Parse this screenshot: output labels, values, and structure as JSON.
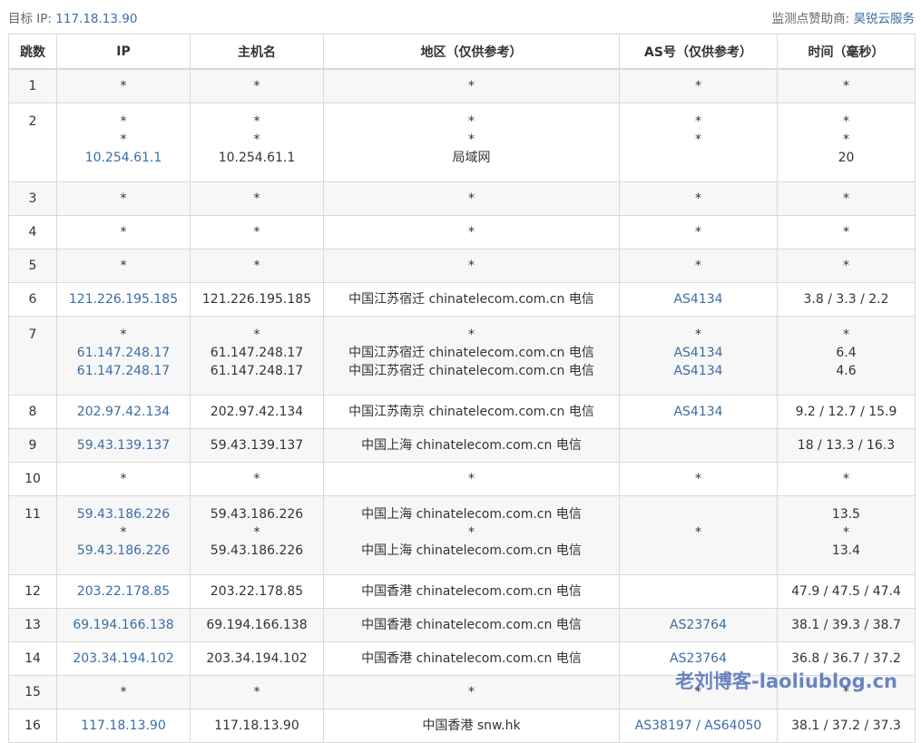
{
  "header": {
    "target_label": "目标 IP:",
    "target_ip": "117.18.13.90",
    "sponsor_label": "监测点赞助商:",
    "sponsor_name": "昊锐云服务"
  },
  "table": {
    "columns": [
      "跳数",
      "IP",
      "主机名",
      "地区（仅供参考）",
      "AS号（仅供参考）",
      "时间（毫秒）"
    ],
    "rows": [
      {
        "hop": "1",
        "ip": [
          "*"
        ],
        "host": [
          "*"
        ],
        "region": [
          "*"
        ],
        "as": [
          "*"
        ],
        "time": [
          "*"
        ]
      },
      {
        "hop": "2",
        "ip": [
          "*",
          "*",
          "10.254.61.1"
        ],
        "host": [
          "*",
          "*",
          "10.254.61.1"
        ],
        "region": [
          "*",
          "*",
          "局域网"
        ],
        "as": [
          "*",
          "*",
          ""
        ],
        "time": [
          "*",
          "*",
          "20"
        ]
      },
      {
        "hop": "3",
        "ip": [
          "*"
        ],
        "host": [
          "*"
        ],
        "region": [
          "*"
        ],
        "as": [
          "*"
        ],
        "time": [
          "*"
        ]
      },
      {
        "hop": "4",
        "ip": [
          "*"
        ],
        "host": [
          "*"
        ],
        "region": [
          "*"
        ],
        "as": [
          "*"
        ],
        "time": [
          "*"
        ]
      },
      {
        "hop": "5",
        "ip": [
          "*"
        ],
        "host": [
          "*"
        ],
        "region": [
          "*"
        ],
        "as": [
          "*"
        ],
        "time": [
          "*"
        ]
      },
      {
        "hop": "6",
        "ip": [
          "121.226.195.185"
        ],
        "host": [
          "121.226.195.185"
        ],
        "region": [
          "中国江苏宿迁 chinatelecom.com.cn 电信"
        ],
        "as": [
          "AS4134"
        ],
        "time": [
          "3.8 / 3.3 / 2.2"
        ]
      },
      {
        "hop": "7",
        "ip": [
          "*",
          "61.147.248.17",
          "61.147.248.17"
        ],
        "host": [
          "*",
          "61.147.248.17",
          "61.147.248.17"
        ],
        "region": [
          "*",
          "中国江苏宿迁 chinatelecom.com.cn 电信",
          "中国江苏宿迁 chinatelecom.com.cn 电信"
        ],
        "as": [
          "*",
          "AS4134",
          "AS4134"
        ],
        "time": [
          "*",
          "6.4",
          "4.6"
        ]
      },
      {
        "hop": "8",
        "ip": [
          "202.97.42.134"
        ],
        "host": [
          "202.97.42.134"
        ],
        "region": [
          "中国江苏南京 chinatelecom.com.cn 电信"
        ],
        "as": [
          "AS4134"
        ],
        "time": [
          "9.2 / 12.7 / 15.9"
        ]
      },
      {
        "hop": "9",
        "ip": [
          "59.43.139.137"
        ],
        "host": [
          "59.43.139.137"
        ],
        "region": [
          "中国上海 chinatelecom.com.cn 电信"
        ],
        "as": [
          ""
        ],
        "time": [
          "18 / 13.3 / 16.3"
        ]
      },
      {
        "hop": "10",
        "ip": [
          "*"
        ],
        "host": [
          "*"
        ],
        "region": [
          "*"
        ],
        "as": [
          "*"
        ],
        "time": [
          "*"
        ]
      },
      {
        "hop": "11",
        "ip": [
          "59.43.186.226",
          "*",
          "59.43.186.226"
        ],
        "host": [
          "59.43.186.226",
          "*",
          "59.43.186.226"
        ],
        "region": [
          "中国上海 chinatelecom.com.cn 电信",
          "*",
          "中国上海 chinatelecom.com.cn 电信"
        ],
        "as": [
          "",
          "*",
          ""
        ],
        "time": [
          "13.5",
          "*",
          "13.4"
        ]
      },
      {
        "hop": "12",
        "ip": [
          "203.22.178.85"
        ],
        "host": [
          "203.22.178.85"
        ],
        "region": [
          "中国香港 chinatelecom.com.cn 电信"
        ],
        "as": [
          ""
        ],
        "time": [
          "47.9 / 47.5 / 47.4"
        ]
      },
      {
        "hop": "13",
        "ip": [
          "69.194.166.138"
        ],
        "host": [
          "69.194.166.138"
        ],
        "region": [
          "中国香港 chinatelecom.com.cn 电信"
        ],
        "as": [
          "AS23764"
        ],
        "time": [
          "38.1 / 39.3 / 38.7"
        ]
      },
      {
        "hop": "14",
        "ip": [
          "203.34.194.102"
        ],
        "host": [
          "203.34.194.102"
        ],
        "region": [
          "中国香港 chinatelecom.com.cn 电信"
        ],
        "as": [
          "AS23764"
        ],
        "time": [
          "36.8 / 36.7 / 37.2"
        ]
      },
      {
        "hop": "15",
        "ip": [
          "*"
        ],
        "host": [
          "*"
        ],
        "region": [
          "*"
        ],
        "as": [
          "*"
        ],
        "time": [
          "*"
        ]
      },
      {
        "hop": "16",
        "ip": [
          "117.18.13.90"
        ],
        "host": [
          "117.18.13.90"
        ],
        "region": [
          "中国香港 snw.hk"
        ],
        "as": [
          "AS38197 / AS64050"
        ],
        "time": [
          "38.1 / 37.2 / 37.3"
        ]
      }
    ]
  },
  "watermark": "老刘博客-laoliublog.cn",
  "colors": {
    "link": "#3a6ea5",
    "border": "#d9d9d9",
    "stripe": "#f7f7f7"
  }
}
